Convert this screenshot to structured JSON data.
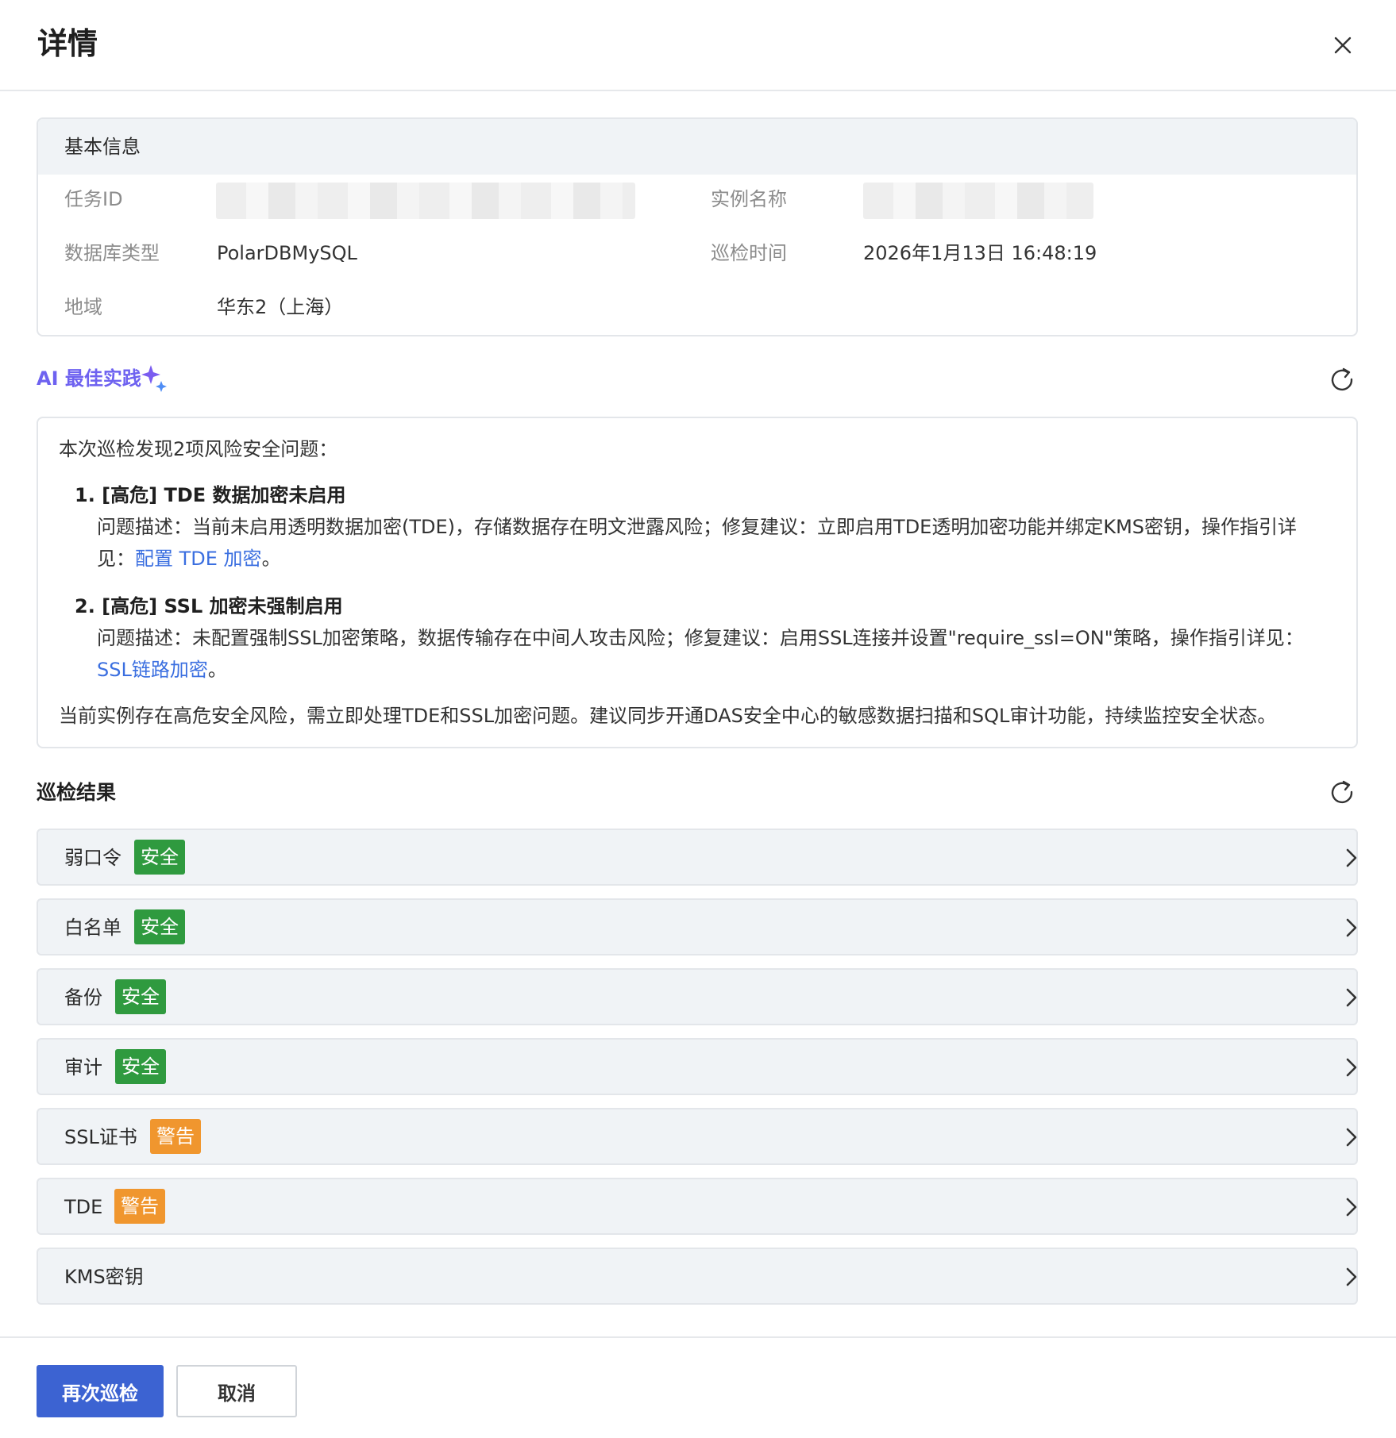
{
  "dialog": {
    "title": "详情"
  },
  "basic_info": {
    "header": "基本信息",
    "fields": {
      "task_id": {
        "label": "任务ID"
      },
      "instance_name": {
        "label": "实例名称"
      },
      "db_type": {
        "label": "数据库类型",
        "value": "PolarDBMySQL"
      },
      "inspect_time": {
        "label": "巡检时间",
        "value": "2026年1月13日 16:48:19"
      },
      "region": {
        "label": "地域",
        "value": "华东2（上海）"
      }
    }
  },
  "ai": {
    "title": "AI 最佳实践",
    "intro": "本次巡检发现2项风险安全问题：",
    "issues": [
      {
        "title": "1. [高危] TDE 数据加密未启用",
        "desc_line1": "问题描述：当前未启用透明数据加密(TDE)，存储数据存在明文泄露风险；修复建议：立即启用TDE透明加密功能并绑定KMS密钥，操作指引详",
        "desc_prefix": "见：",
        "link": "配置 TDE 加密",
        "suffix": "。"
      },
      {
        "title": "2. [高危] SSL 加密未强制启用",
        "desc_line1": "问题描述：未配置强制SSL加密策略，数据传输存在中间人攻击风险；修复建议：启用SSL连接并设置\"require_ssl=ON\"策略，操作指引详见：",
        "link": "SSL链路加密",
        "suffix": "。"
      }
    ],
    "summary": "当前实例存在高危安全风险，需立即处理TDE和SSL加密问题。建议同步开通DAS安全中心的敏感数据扫描和SQL审计功能，持续监控安全状态。"
  },
  "results": {
    "title": "巡检结果",
    "items": [
      {
        "label": "弱口令",
        "status": "安全"
      },
      {
        "label": "白名单",
        "status": "安全"
      },
      {
        "label": "备份",
        "status": "安全"
      },
      {
        "label": "审计",
        "status": "安全"
      },
      {
        "label": "SSL证书",
        "status": "警告"
      },
      {
        "label": "TDE",
        "status": "警告"
      },
      {
        "label": "KMS密钥"
      }
    ]
  },
  "footer": {
    "primary_label": "再次巡检",
    "cancel_label": "取消"
  },
  "colors": {
    "primary": "#3c63d2",
    "safe": "#2f9a3f",
    "warn": "#f0962e",
    "link": "#3b6fe0",
    "ai_accent": "#6e62f0"
  },
  "icons": {
    "close": "close-icon",
    "sparkle": "sparkle-icon",
    "refresh": "refresh-icon",
    "chevron": "chevron-right-icon"
  }
}
